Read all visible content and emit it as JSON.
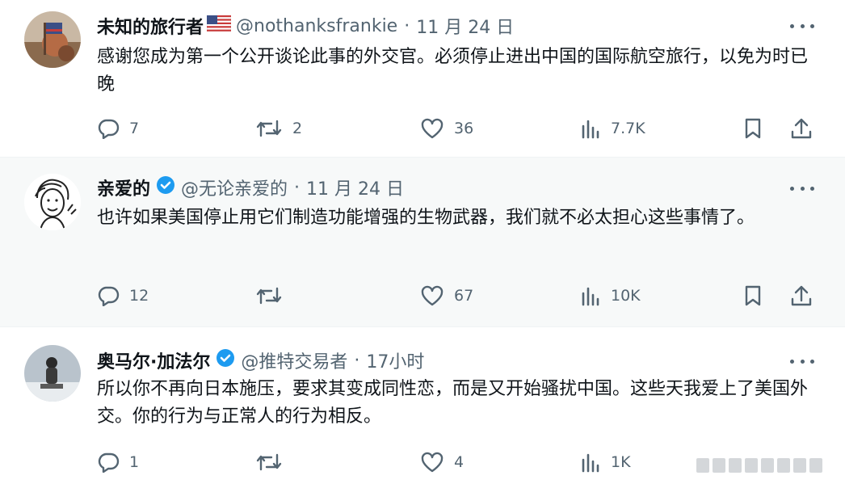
{
  "tweets": [
    {
      "name": "未知的旅行者",
      "badge_icon": "us-flag-icon",
      "handle": "@nothanksfrankie",
      "separator": "·",
      "time": "11 月 24 日",
      "text": "感谢您成为第一个公开谈论此事的外交官。必须停止进出中国的国际航空旅行，以免为时已晚",
      "replies": "7",
      "retweets": "2",
      "likes": "36",
      "views": "7.7K"
    },
    {
      "name": "亲爱的",
      "badge_icon": "verified-icon",
      "handle": "@无论亲爱的",
      "separator": "·",
      "time": "11 月 24 日",
      "text": "也许如果美国停止用它们制造功能增强的生物武器，我们就不必太担心这些事情了。",
      "replies": "12",
      "retweets": "",
      "likes": "67",
      "views": "10K"
    },
    {
      "name": "奥马尔·加法尔",
      "badge_icon": "verified-icon",
      "handle": "@推特交易者",
      "separator": "·",
      "time": "17小时",
      "text": "所以你不再向日本施压，要求其变成同性恋，而是又开始骚扰中国。这些天我爱上了美国外交。你的行为与正常人的行为相反。",
      "replies": "1",
      "retweets": "",
      "likes": "4",
      "views": "1K"
    }
  ],
  "colors": {
    "text": "#0f1419",
    "secondary": "#536471",
    "verified": "#1d9bf0",
    "divider": "#eff3f4",
    "highlight_bg": "#f7f9f9"
  }
}
